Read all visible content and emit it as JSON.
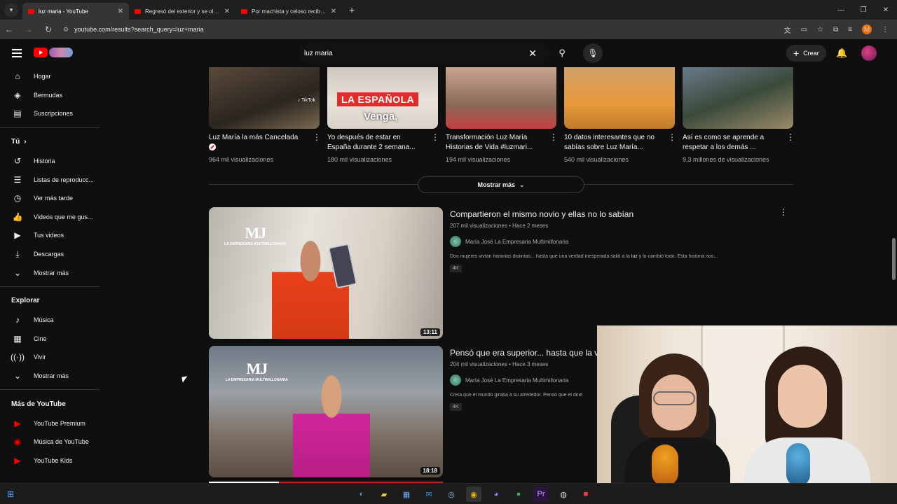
{
  "browser": {
    "tabs": [
      {
        "title": "luz maria - YouTube",
        "active": true
      },
      {
        "title": "Regresó del exterior y se olvidó"
      },
      {
        "title": "Por machista y celoso recibió u"
      }
    ],
    "url": "youtube.com/results?search_query=luz+maria"
  },
  "masthead": {
    "search_value": "luz maria",
    "create_label": "Crear"
  },
  "sidebar": {
    "main": [
      {
        "label": "Hogar",
        "icon": "home-icon"
      },
      {
        "label": "Bermudas",
        "icon": "shorts-icon"
      },
      {
        "label": "Suscripciones",
        "icon": "subscriptions-icon"
      }
    ],
    "you_heading": "Tú",
    "you": [
      {
        "label": "Historia",
        "icon": "history-icon"
      },
      {
        "label": "Listas de reproducc...",
        "icon": "playlists-icon"
      },
      {
        "label": "Ver más tarde",
        "icon": "watch-later-icon"
      },
      {
        "label": "Videos que me gus...",
        "icon": "like-icon"
      },
      {
        "label": "Tus videos",
        "icon": "your-videos-icon"
      },
      {
        "label": "Descargas",
        "icon": "download-icon"
      },
      {
        "label": "Mostrar más",
        "icon": "chevron-down-icon"
      }
    ],
    "explore_heading": "Explorar",
    "explore": [
      {
        "label": "Música",
        "icon": "music-icon"
      },
      {
        "label": "Cine",
        "icon": "movies-icon"
      },
      {
        "label": "Vivir",
        "icon": "live-icon"
      },
      {
        "label": "Mostrar más",
        "icon": "chevron-down-icon"
      }
    ],
    "more_heading": "Más de YouTube",
    "more": [
      {
        "label": "YouTube Premium",
        "icon": "youtube-premium-icon"
      },
      {
        "label": "Música de YouTube",
        "icon": "youtube-music-icon"
      },
      {
        "label": "YouTube Kids",
        "icon": "youtube-kids-icon"
      }
    ]
  },
  "shorts": [
    {
      "title": "Luz María la más Cancelada",
      "views": "964 mil visualizaciones"
    },
    {
      "title": "Yo después de estar en España durante 2 semana...",
      "views": "180 mil visualizaciones",
      "overlay1": "LA ESPAÑOLA",
      "overlay2": "Venga,"
    },
    {
      "title": "Transformación Luz María Historias de Vida #luzmari...",
      "views": "194 mil visualizaciones"
    },
    {
      "title": "10 datos interesantes que no sabías sobre Luz María...",
      "views": "540 mil visualizaciones"
    },
    {
      "title": "Así es como se aprende a respetar a los demás ...",
      "views": "9,3 millones de visualizaciones"
    }
  ],
  "show_more_label": "Mostrar más",
  "videos": [
    {
      "title": "Compartieron el mismo novio y ellas no lo sabían",
      "views": "207 mil visualizaciones",
      "age": "Hace 2 meses",
      "channel": "María José La Empresaria Multimillonaria",
      "desc_pre": "Dos mujeres vivían historias distintas... hasta que una verdad inesperada salió a la ",
      "desc_bold": "luz",
      "desc_post": " y lo cambió todo. Esta historia nos...",
      "quality": "4K",
      "duration": "13:11",
      "logo": "MJ",
      "logo_sub": "LA EMPRESARIA MULTIMILLONARIA"
    },
    {
      "title": "Pensó que era superior... hasta que la vi",
      "views": "204 mil visualizaciones",
      "age": "Hace 3 meses",
      "channel": "María José La Empresaria Multimillonaria",
      "desc_pre": "Creía que el mundo giraba a su alrededor. Pensó que el dine",
      "desc_bold": "",
      "desc_post": "",
      "quality": "4K",
      "duration": "18:18",
      "logo": "MJ",
      "logo_sub": "LA EMPRESARIA MULTIMILLONARIA"
    }
  ],
  "sep": "•"
}
